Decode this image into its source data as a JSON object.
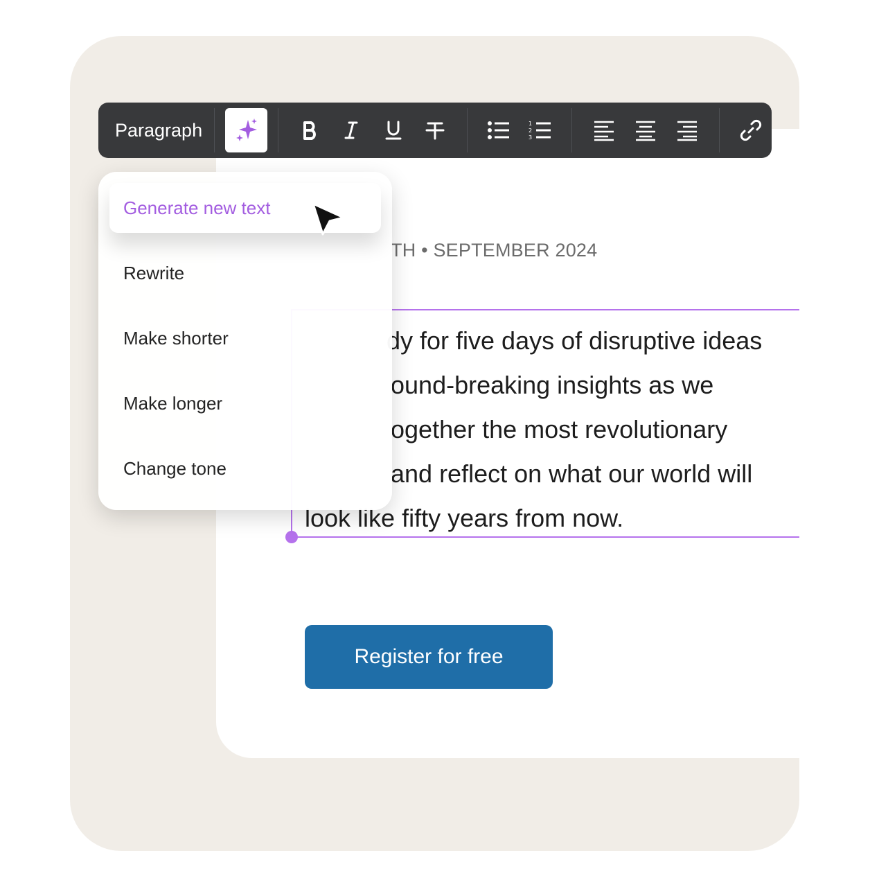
{
  "toolbar": {
    "style_label": "Paragraph",
    "buttons": [
      {
        "name": "ai-sparkle",
        "icon": "sparkle-icon",
        "active": true
      },
      {
        "name": "bold",
        "icon": "bold-icon"
      },
      {
        "name": "italic",
        "icon": "italic-icon"
      },
      {
        "name": "underline",
        "icon": "underline-icon"
      },
      {
        "name": "strikethrough",
        "icon": "strikethrough-icon"
      },
      {
        "name": "bullet-list",
        "icon": "bullet-list-icon"
      },
      {
        "name": "numbered-list",
        "icon": "numbered-list-icon"
      },
      {
        "name": "align-left",
        "icon": "align-left-icon"
      },
      {
        "name": "align-center",
        "icon": "align-center-icon"
      },
      {
        "name": "align-right",
        "icon": "align-right-icon"
      },
      {
        "name": "link",
        "icon": "link-icon"
      }
    ]
  },
  "ai_menu": {
    "items": [
      {
        "label": "Generate new text",
        "highlighted": true
      },
      {
        "label": "Rewrite"
      },
      {
        "label": "Make shorter"
      },
      {
        "label": "Make longer"
      },
      {
        "label": "Change tone"
      }
    ]
  },
  "document": {
    "eyebrow": "TH • SEPTEMBER 2024",
    "body_lines": [
      "dy for five days of disruptive ideas",
      "ound-breaking insights as we",
      "ogether the most revolutionary",
      "and reflect on what our world will",
      "look like fifty years from now."
    ],
    "cta_label": "Register for free"
  },
  "colors": {
    "accent": "#a35de0",
    "selection": "#b572ec",
    "toolbar_bg": "#38393b",
    "cta_bg": "#1f6ea8",
    "backdrop": "#f1ede7"
  }
}
